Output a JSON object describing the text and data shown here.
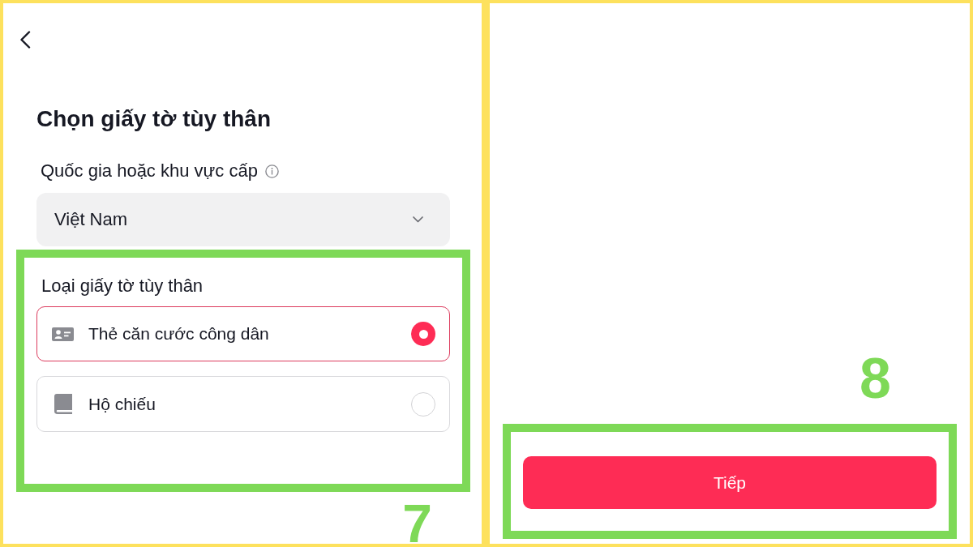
{
  "header": {
    "title": "Chọn giấy tờ tùy thân"
  },
  "country": {
    "label": "Quốc gia hoặc khu vực cấp",
    "value": "Việt Nam"
  },
  "id_type": {
    "label": "Loại giấy tờ tùy thân",
    "options": [
      {
        "kind": "id_card",
        "label": "Thẻ căn cước công dân",
        "selected": true
      },
      {
        "kind": "passport",
        "label": "Hộ chiếu",
        "selected": false
      }
    ]
  },
  "next_button": {
    "label": "Tiếp"
  },
  "callouts": [
    {
      "number": "7"
    },
    {
      "number": "8"
    }
  ]
}
